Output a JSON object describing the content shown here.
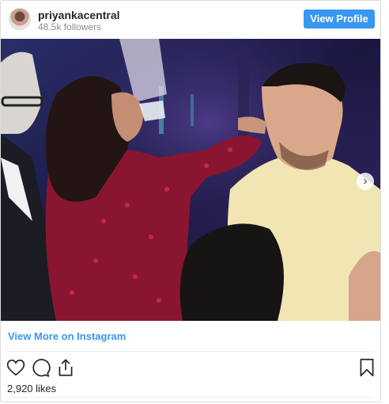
{
  "header": {
    "username": "priyankacentral",
    "followers": "48.5k followers",
    "view_profile_label": "View Profile"
  },
  "post": {
    "photo_alt": "Photo",
    "next_icon": "chevron-right-icon",
    "view_more_label": "View More on Instagram",
    "likes": "2,920 likes"
  },
  "actions": {
    "like_icon": "heart-icon",
    "comment_icon": "comment-icon",
    "share_icon": "share-icon",
    "save_icon": "bookmark-icon"
  },
  "colors": {
    "accent": "#3897f0",
    "muted_text": "#8e8e8e",
    "border": "#dbdbdb"
  }
}
